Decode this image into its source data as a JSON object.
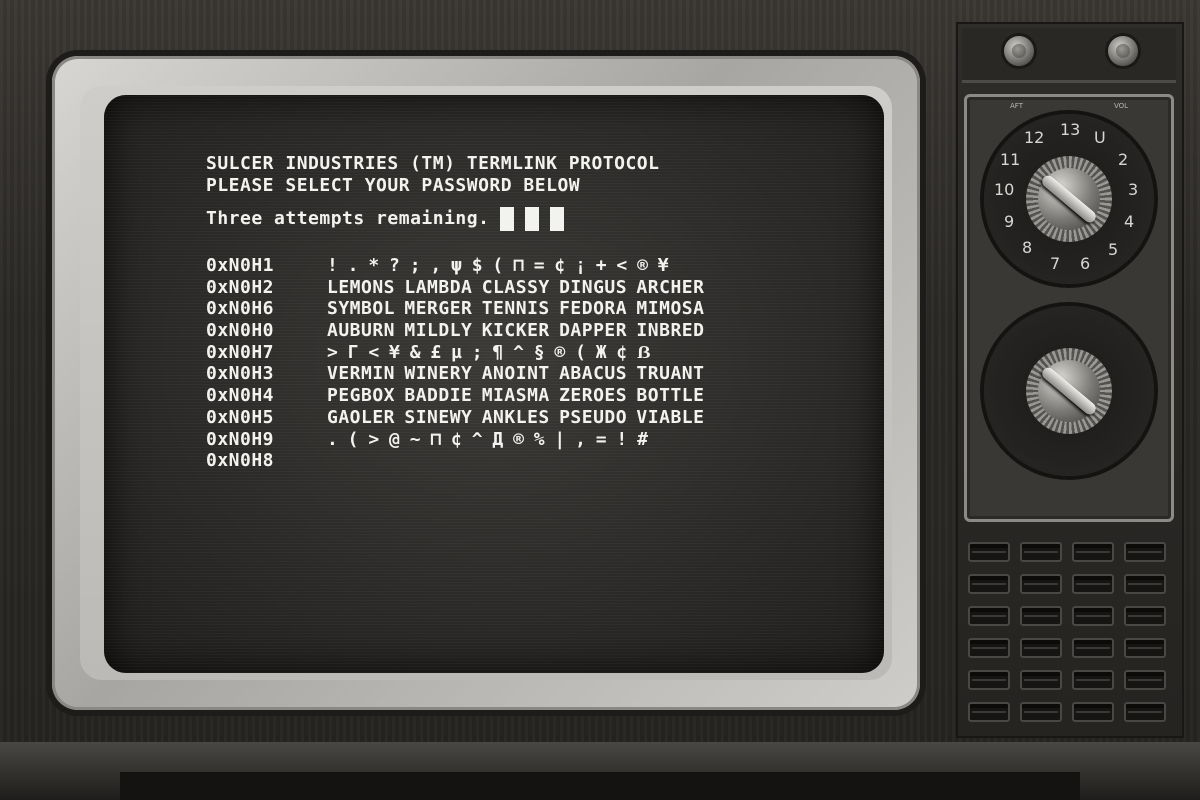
{
  "terminal": {
    "header_line1": "SULCER INDUSTRIES (TM) TERMLINK PROTOCOL",
    "header_line2": "PLEASE SELECT YOUR PASSWORD BELOW",
    "attempts_text": "Three attempts remaining.",
    "attempts_remaining": 3,
    "rows": [
      {
        "address": "0xN0H1",
        "content": "! . * ? ; , ψ $ ( ⊓ = ¢ ¡ + < ® ¥"
      },
      {
        "address": "0xN0H2",
        "content": "LEMONS LAMBDA CLASSY DINGUS ARCHER"
      },
      {
        "address": "0xN0H6",
        "content": "SYMBOL MERGER TENNIS FEDORA MIMOSA"
      },
      {
        "address": "0xN0H0",
        "content": "AUBURN MILDLY KICKER DAPPER INBRED"
      },
      {
        "address": "0xN0H7",
        "content": "> Γ < ¥ & £ µ ; ¶ ^ § ® ( Ж ¢ ẞ"
      },
      {
        "address": "0xN0H3",
        "content": "VERMIN WINERY ANOINT ABACUS TRUANT"
      },
      {
        "address": "0xN0H4",
        "content": "PEGBOX BADDIE MIASMA ZEROES BOTTLE"
      },
      {
        "address": "0xN0H5",
        "content": "GAOLER SINEWY ANKLES PSEUDO VIABLE"
      },
      {
        "address": "0xN0H9",
        "content": ". ( > @ ~ ⊓ ¢ ^ Д ® % | , = ! #"
      },
      {
        "address": "0xN0H8",
        "content": ""
      }
    ]
  },
  "tv": {
    "dial_labels": [
      "AFT",
      "VOL"
    ],
    "channel_numbers": [
      "13",
      "U",
      "2",
      "3",
      "4",
      "5",
      "6",
      "7",
      "8",
      "9",
      "10",
      "11",
      "12"
    ]
  }
}
